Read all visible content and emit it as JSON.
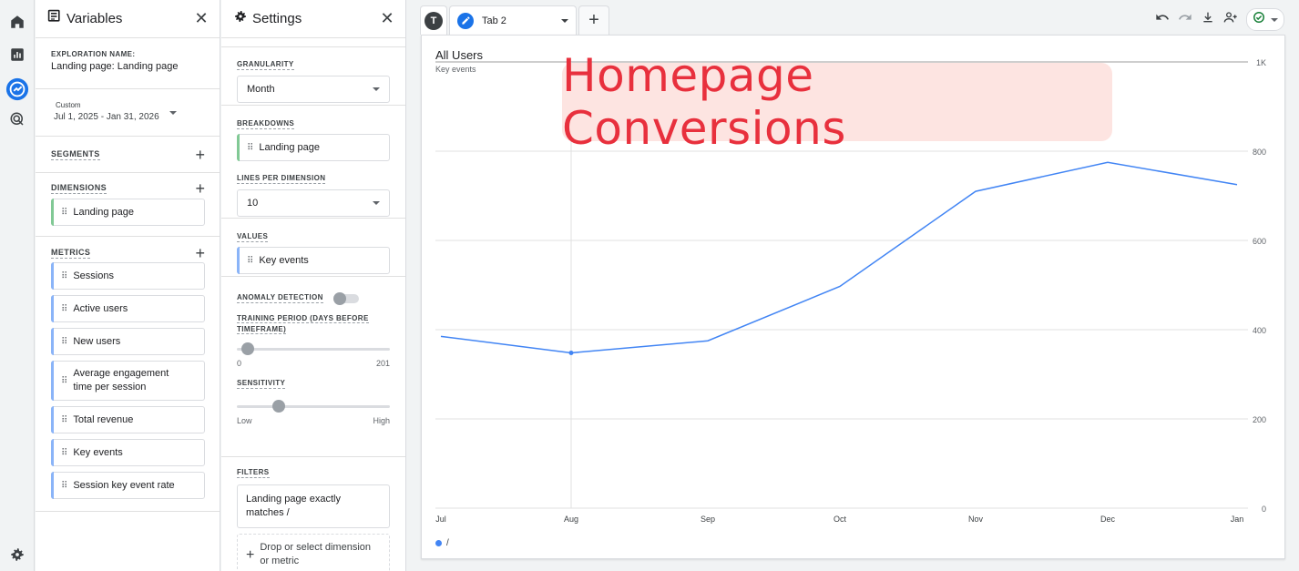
{
  "rail": {
    "items": [
      {
        "name": "home-icon"
      },
      {
        "name": "reports-icon"
      },
      {
        "name": "explore-icon"
      },
      {
        "name": "advertising-icon"
      },
      {
        "name": "settings-icon"
      }
    ]
  },
  "variables": {
    "title": "Variables",
    "exploration_label": "EXPLORATION NAME:",
    "exploration_name": "Landing page: Landing page",
    "date_label": "Custom",
    "date_range": "Jul 1, 2025 - Jan 31, 2026",
    "segments_label": "SEGMENTS",
    "dimensions_label": "DIMENSIONS",
    "dimensions": [
      "Landing page"
    ],
    "metrics_label": "METRICS",
    "metrics": [
      "Sessions",
      "Active users",
      "New users",
      "Average engagement time per session",
      "Total revenue",
      "Key events",
      "Session key event rate"
    ]
  },
  "settings": {
    "title": "Settings",
    "granularity_label": "GRANULARITY",
    "granularity_value": "Month",
    "breakdowns_label": "BREAKDOWNS",
    "breakdown": "Landing page",
    "lines_label": "LINES PER DIMENSION",
    "lines_value": "10",
    "values_label": "VALUES",
    "value": "Key events",
    "anomaly_label": "ANOMALY DETECTION",
    "anomaly_enabled": false,
    "training_label": "TRAINING PERIOD (DAYS BEFORE TIMEFRAME)",
    "training_min": "0",
    "training_max": "201",
    "training_value": 0,
    "sensitivity_label": "SENSITIVITY",
    "sensitivity_low": "Low",
    "sensitivity_high": "High",
    "sensitivity_value": 0.25,
    "filters_label": "FILTERS",
    "filter_text": "Landing page exactly matches /",
    "drop_text": "Drop or select dimension or metric"
  },
  "tabs": {
    "user_initial": "T",
    "active_tab": "Tab 2"
  },
  "banner": {
    "text": "Homepage Conversions"
  },
  "chart_data": {
    "type": "line",
    "title": "All Users",
    "ylabel": "Key events",
    "categories": [
      "Jul",
      "Aug",
      "Sep",
      "Oct",
      "Nov",
      "Dec",
      "Jan"
    ],
    "series": [
      {
        "name": "/",
        "values": [
          385,
          348,
          375,
          497,
          710,
          775,
          725
        ],
        "color": "#4285f4"
      }
    ],
    "yticks": [
      0,
      200,
      400,
      600,
      800,
      1000
    ],
    "ytick_labels": [
      "0",
      "200",
      "400",
      "600",
      "800",
      "1K"
    ],
    "ylim": [
      0,
      1000
    ],
    "grid": true,
    "legend": "bottom-left"
  }
}
